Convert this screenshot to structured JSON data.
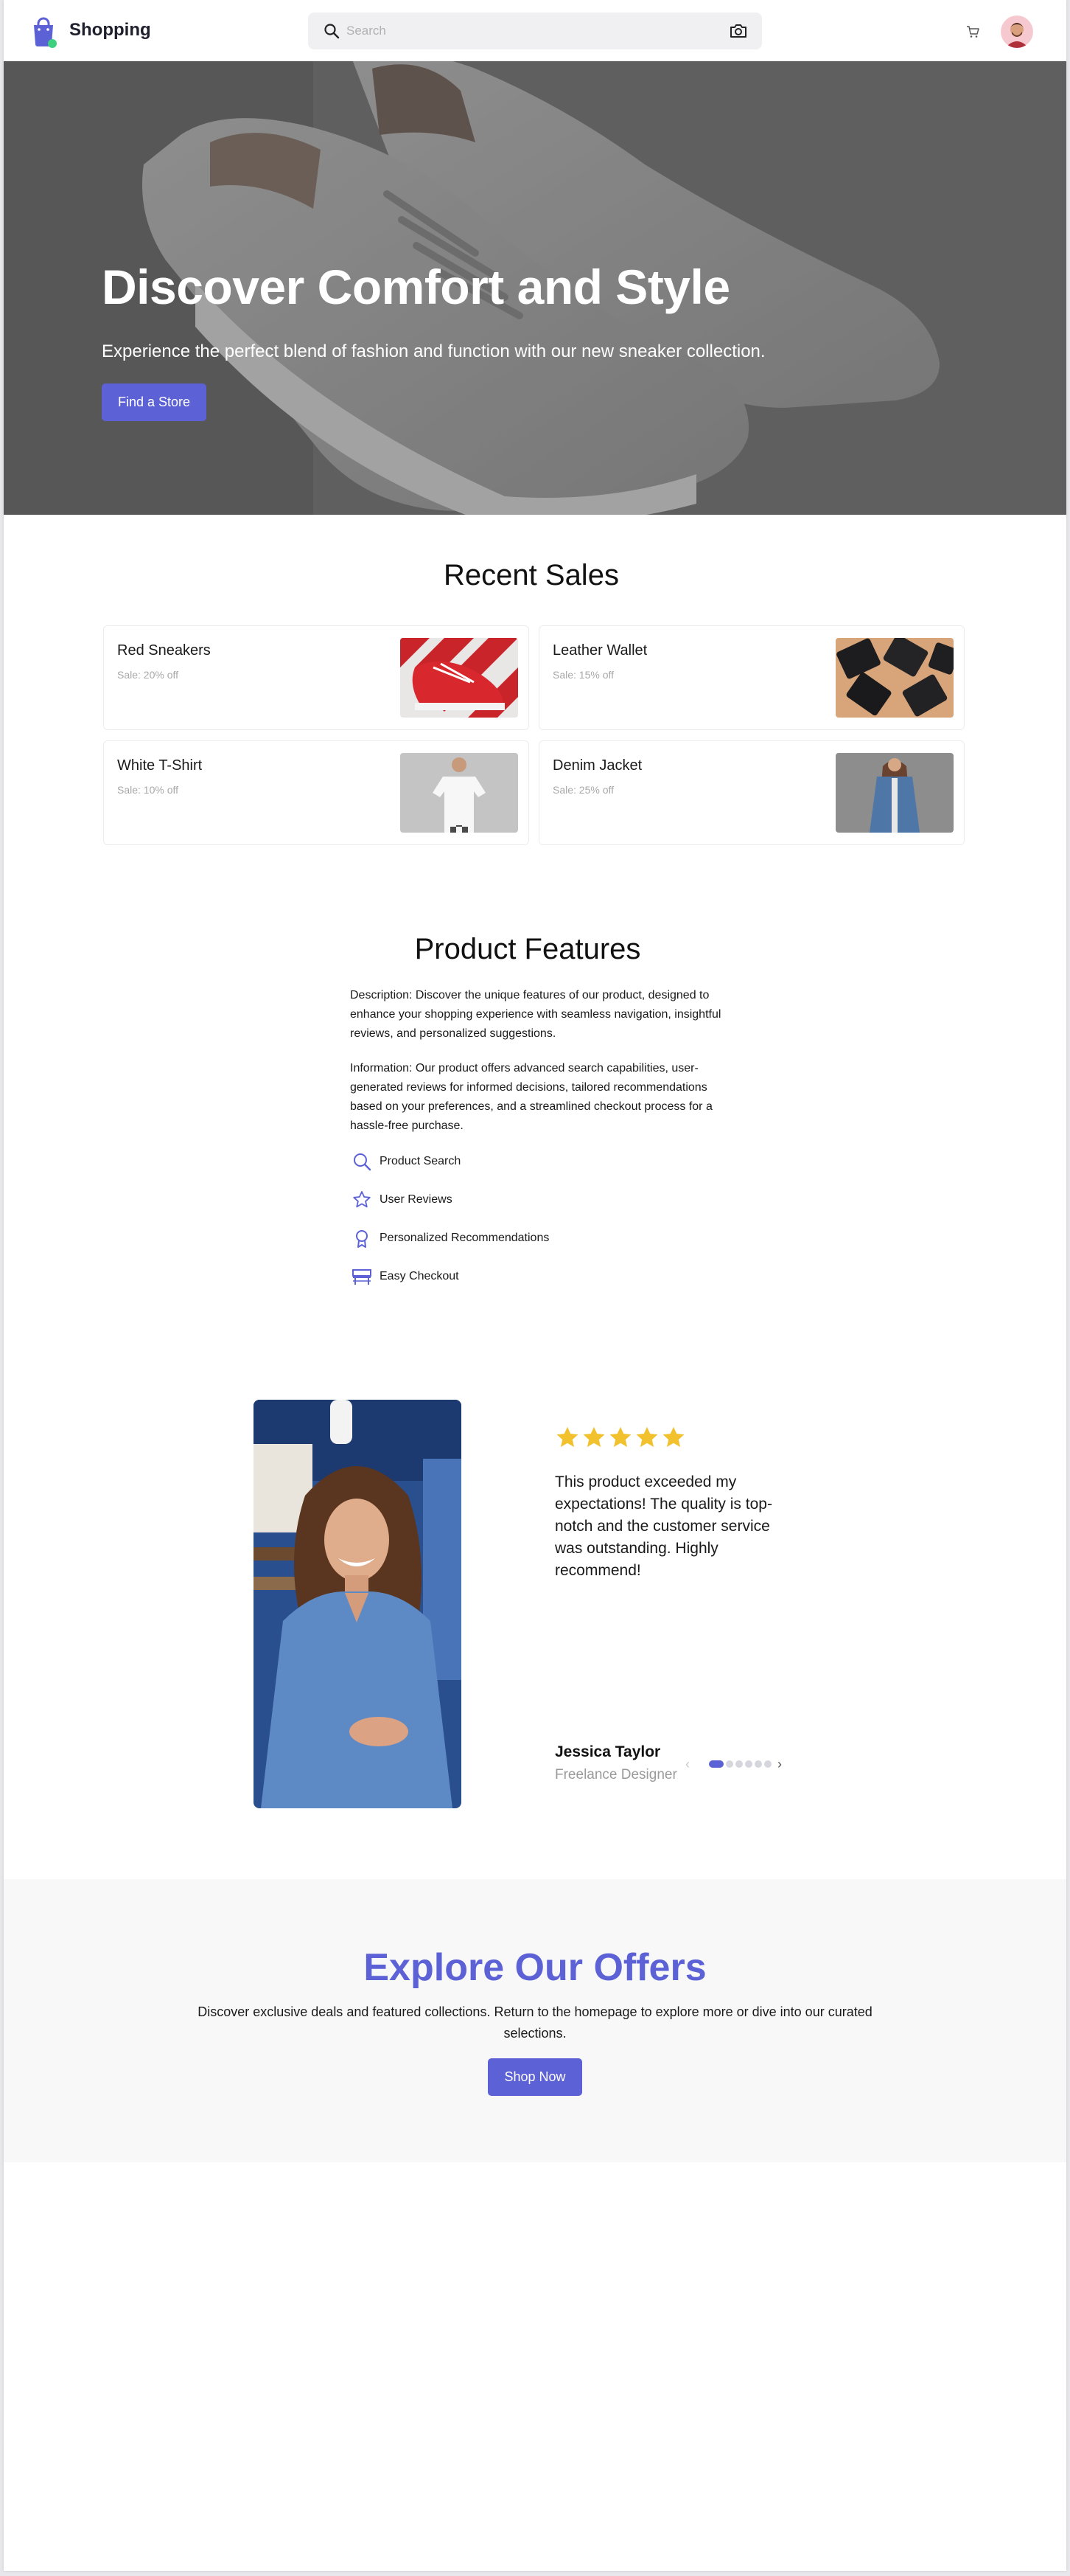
{
  "header": {
    "brand": "Shopping",
    "search_placeholder": "Search"
  },
  "hero": {
    "title": "Discover Comfort and Style",
    "subtitle": "Experience the perfect blend of fashion and function with our new sneaker collection.",
    "button": "Find a Store"
  },
  "sales": {
    "title": "Recent Sales",
    "items": [
      {
        "name": "Red Sneakers",
        "info": "Sale: 20% off"
      },
      {
        "name": "Leather Wallet",
        "info": "Sale: 15% off"
      },
      {
        "name": "White T-Shirt",
        "info": "Sale: 10% off"
      },
      {
        "name": "Denim Jacket",
        "info": "Sale: 25% off"
      }
    ]
  },
  "features": {
    "title": "Product Features",
    "description": "Description: Discover the unique features of our product, designed to enhance your shopping experience with seamless navigation, insightful reviews, and personalized suggestions.",
    "information": "Information: Our product offers advanced search capabilities, user-generated reviews for informed decisions, tailored recommendations based on your preferences, and a streamlined checkout process for a hassle-free purchase.",
    "items": [
      {
        "label": "Product Search",
        "icon": "search-icon"
      },
      {
        "label": "User Reviews",
        "icon": "star-icon"
      },
      {
        "label": "Personalized Recommendations",
        "icon": "award-icon"
      },
      {
        "label": "Easy Checkout",
        "icon": "checkout-icon"
      }
    ]
  },
  "testimonial": {
    "rating": 5,
    "quote": "This product exceeded my expectations! The quality is top-notch and the customer service was outstanding. Highly recommend!",
    "name": "Jessica Taylor",
    "role": "Freelance Designer",
    "slides": 6,
    "active_slide": 0
  },
  "offers": {
    "title": "Explore Our Offers",
    "text": "Discover exclusive deals and featured collections. Return to the homepage to explore more or dive into our curated selections.",
    "button": "Shop Now"
  },
  "colors": {
    "accent": "#5c62d6",
    "star": "#f2c12e"
  }
}
